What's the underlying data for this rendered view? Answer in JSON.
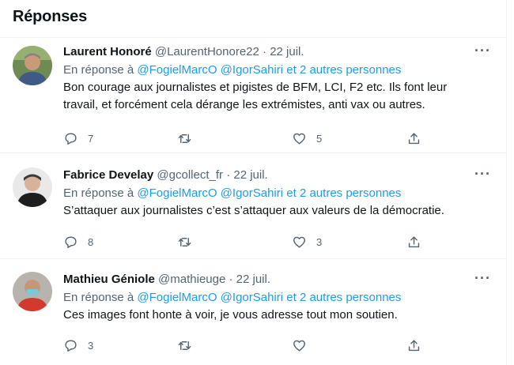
{
  "header": {
    "title": "Réponses"
  },
  "tweets": [
    {
      "name": "Laurent Honoré",
      "handle": "@LaurentHonore22",
      "dot": "·",
      "date": "22 juil.",
      "more": "···",
      "reply_prefix": "En réponse à",
      "reply_user1": "@FogielMarcO",
      "reply_user2": "@IgorSahiri",
      "reply_others": "et 2 autres personnes",
      "text_line1": "Bon courage aux journalistes et pigistes de BFM, LCI, F2 etc. Ils font leur",
      "text_line2": "travail, et forcément cela dérange les extrémistes, anti vax ou autres.",
      "replies": "7",
      "retweets": "",
      "likes": "5"
    },
    {
      "name": "Fabrice Develay",
      "handle": "@gcollect_fr",
      "dot": "·",
      "date": "22 juil.",
      "more": "···",
      "reply_prefix": "En réponse à",
      "reply_user1": "@FogielMarcO",
      "reply_user2": "@IgorSahiri",
      "reply_others": "et 2 autres personnes",
      "text_line1": "S’attaquer aux journalistes c’est s’attaquer aux valeurs de la démocratie.",
      "replies": "8",
      "retweets": "",
      "likes": "3"
    },
    {
      "name": "Mathieu Géniole",
      "handle": "@mathieuge",
      "dot": "·",
      "date": "22 juil.",
      "more": "···",
      "reply_prefix": "En réponse à",
      "reply_user1": "@FogielMarcO",
      "reply_user2": "@IgorSahiri",
      "reply_others": "et 2 autres personnes",
      "text_line1": "Ces images font honte à voir, je vous adresse tout mon soutien.",
      "replies": "3",
      "retweets": "",
      "likes": ""
    }
  ],
  "icons": {
    "reply": "reply-icon",
    "retweet": "retweet-icon",
    "like": "heart-icon",
    "share": "share-icon",
    "more": "more-icon"
  },
  "colors": {
    "link": "#1d9bf0",
    "secondary_text": "#536471",
    "primary_text": "#0f1419",
    "divider": "#eff3f4"
  }
}
